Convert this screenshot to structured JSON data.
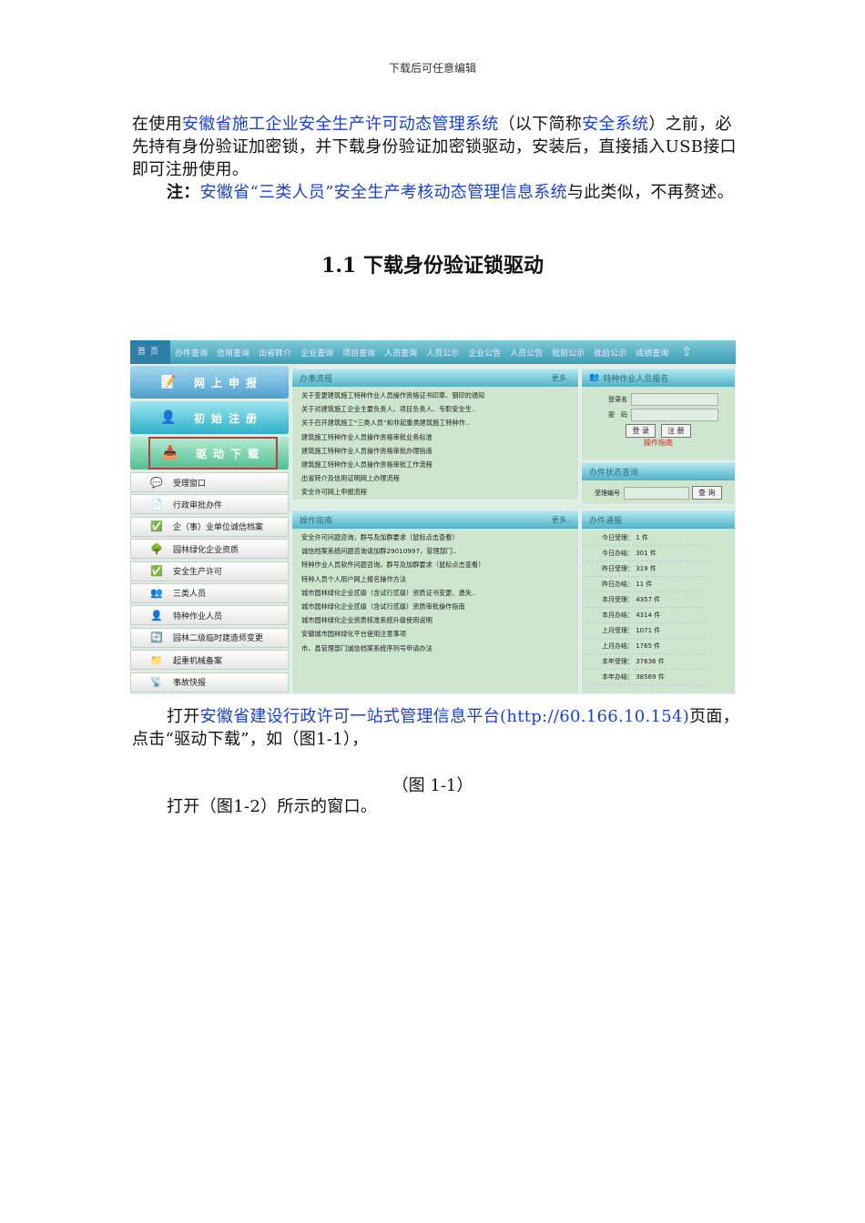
{
  "header": "下载后可任意编辑",
  "intro": {
    "t1": "在使用",
    "link1": "安徽省施工企业安全生产许可动态管理系统",
    "t2": "（以下简称",
    "link2": "安全系统",
    "t3": "）之前，必先持有身份验证加密锁，并下载身份验证加密锁驱动，安装后，直接插入USB接口即可注册使用。"
  },
  "note": {
    "label": "注：",
    "link": "安徽省“三类人员”安全生产考核动态管理信息系统",
    "text": "与此类似，不再赘述。"
  },
  "heading": "1.1 下载身份验证锁驱动",
  "screenshot": {
    "nav": [
      "首页",
      "办件查询",
      "信用查询",
      "出省转介",
      "企业查询",
      "项目查询",
      "人员查询",
      "人员公示",
      "企业公告",
      "人员公告",
      "批前公示",
      "批后公示",
      "成绩查询"
    ],
    "big_buttons": [
      "网上申报",
      "初始注册",
      "驱动下载"
    ],
    "menu": [
      {
        "icon": "chat-icon",
        "label": "受理窗口"
      },
      {
        "icon": "doc-add-icon",
        "label": "行政审批办件"
      },
      {
        "icon": "doc-check-icon",
        "label": "企（事）业单位诚信档案"
      },
      {
        "icon": "tree-icon",
        "label": "园林绿化企业资质"
      },
      {
        "icon": "doc-check-icon",
        "label": "安全生产许可"
      },
      {
        "icon": "users-icon",
        "label": "三类人员"
      },
      {
        "icon": "user-icon",
        "label": "特种作业人员"
      },
      {
        "icon": "swap-icon",
        "label": "园林二级临时建造师变更"
      },
      {
        "icon": "folder-add-icon",
        "label": "起重机械备案"
      },
      {
        "icon": "rss-icon",
        "label": "事故快报"
      }
    ],
    "process": {
      "title": "办事流程",
      "more": "更多..",
      "items": [
        "关于变更建筑施工特种作业人员操作资格证书印章、钢印的通知",
        "关于对建筑施工企业主要负责人、项目负责人、专职安全生..",
        "关于召开建筑施工“三类人员”和非起重类建筑施工特种作..",
        "建筑施工特种作业人员操作资格审批业务标准",
        "建筑施工特种作业人员操作资格审批办理指南",
        "建筑施工特种作业人员操作资格审批工作流程",
        "出省转介及信用证明网上办理流程",
        "安全许可网上申报流程"
      ]
    },
    "guide": {
      "title": "操作指南",
      "more": "更多..",
      "items": [
        "安全许可问题咨询，群号及加群要求（鼠标点击查看）",
        "诚信档案系统问题咨询请加群29010997，管理部门..",
        "特种作业人员软件问题咨询，群号及加群要求（鼠标点击查看）",
        "特种人员个人用户网上报名操作方法",
        "城市园林绿化企业贰级（含试行贰级）资质证书变更、遗失..",
        "城市园林绿化企业贰级（含试行贰级）资质审批操作指南",
        "城市园林绿化企业资质核准系统升级使用说明",
        "安徽城市园林绿化平台使用注意事项",
        "市、县管理部门诚信档案系统序列号申请办法"
      ]
    },
    "signup": {
      "title": "特种作业人员报名",
      "username_label": "登录名",
      "password_label": "密　码",
      "login": "登 录",
      "register": "注 册",
      "guide_link": "操作指南"
    },
    "status": {
      "title": "办件状态查询",
      "label": "受理编号",
      "query": "查 询"
    },
    "report": {
      "title": "办件通报",
      "items": [
        "今日受理： 1 件",
        "今日办结： 301 件",
        "昨日受理： 319 件",
        "昨日办结： 11 件",
        "本月受理： 4357 件",
        "本月办结： 4314 件",
        "上月受理： 1071 件",
        "上月办结： 1765 件",
        "本年受理： 37636 件",
        "本年办结： 38569 件"
      ]
    }
  },
  "para2": {
    "t1": "打开",
    "link": "安徽省建设行政许可一站式管理信息平台(http://60.166.10.154)",
    "t2": "页面，点击“驱动下载”，如（图1-1），"
  },
  "caption": "（图 1-1）",
  "para3": "打开（图1-2）所示的窗口。"
}
